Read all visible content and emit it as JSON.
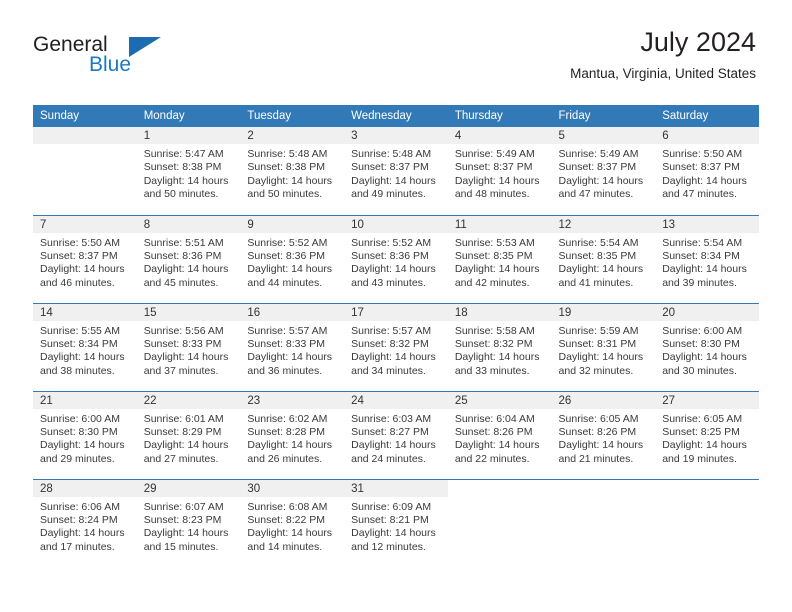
{
  "brand": {
    "word_general": "General",
    "word_blue": "Blue"
  },
  "header": {
    "title": "July 2024",
    "subtitle": "Mantua, Virginia, United States"
  },
  "colors": {
    "header_blue": "#3279b7",
    "logo_blue": "#1b79c3",
    "daynum_band": "#f0f0f0",
    "text": "#231f20"
  },
  "calendar": {
    "weekday_headers": [
      "Sunday",
      "Monday",
      "Tuesday",
      "Wednesday",
      "Thursday",
      "Friday",
      "Saturday"
    ],
    "labels": {
      "sunrise_prefix": "Sunrise:",
      "sunset_prefix": "Sunset:",
      "daylight_prefix": "Daylight:"
    },
    "weeks": [
      [
        {
          "day": "",
          "empty": true,
          "line1": "",
          "line2": "",
          "line3": "",
          "line4": ""
        },
        {
          "day": "1",
          "line1": "Sunrise: 5:47 AM",
          "line2": "Sunset: 8:38 PM",
          "line3": "Daylight: 14 hours",
          "line4": "and 50 minutes."
        },
        {
          "day": "2",
          "line1": "Sunrise: 5:48 AM",
          "line2": "Sunset: 8:38 PM",
          "line3": "Daylight: 14 hours",
          "line4": "and 50 minutes."
        },
        {
          "day": "3",
          "line1": "Sunrise: 5:48 AM",
          "line2": "Sunset: 8:37 PM",
          "line3": "Daylight: 14 hours",
          "line4": "and 49 minutes."
        },
        {
          "day": "4",
          "line1": "Sunrise: 5:49 AM",
          "line2": "Sunset: 8:37 PM",
          "line3": "Daylight: 14 hours",
          "line4": "and 48 minutes."
        },
        {
          "day": "5",
          "line1": "Sunrise: 5:49 AM",
          "line2": "Sunset: 8:37 PM",
          "line3": "Daylight: 14 hours",
          "line4": "and 47 minutes."
        },
        {
          "day": "6",
          "line1": "Sunrise: 5:50 AM",
          "line2": "Sunset: 8:37 PM",
          "line3": "Daylight: 14 hours",
          "line4": "and 47 minutes."
        }
      ],
      [
        {
          "day": "7",
          "line1": "Sunrise: 5:50 AM",
          "line2": "Sunset: 8:37 PM",
          "line3": "Daylight: 14 hours",
          "line4": "and 46 minutes."
        },
        {
          "day": "8",
          "line1": "Sunrise: 5:51 AM",
          "line2": "Sunset: 8:36 PM",
          "line3": "Daylight: 14 hours",
          "line4": "and 45 minutes."
        },
        {
          "day": "9",
          "line1": "Sunrise: 5:52 AM",
          "line2": "Sunset: 8:36 PM",
          "line3": "Daylight: 14 hours",
          "line4": "and 44 minutes."
        },
        {
          "day": "10",
          "line1": "Sunrise: 5:52 AM",
          "line2": "Sunset: 8:36 PM",
          "line3": "Daylight: 14 hours",
          "line4": "and 43 minutes."
        },
        {
          "day": "11",
          "line1": "Sunrise: 5:53 AM",
          "line2": "Sunset: 8:35 PM",
          "line3": "Daylight: 14 hours",
          "line4": "and 42 minutes."
        },
        {
          "day": "12",
          "line1": "Sunrise: 5:54 AM",
          "line2": "Sunset: 8:35 PM",
          "line3": "Daylight: 14 hours",
          "line4": "and 41 minutes."
        },
        {
          "day": "13",
          "line1": "Sunrise: 5:54 AM",
          "line2": "Sunset: 8:34 PM",
          "line3": "Daylight: 14 hours",
          "line4": "and 39 minutes."
        }
      ],
      [
        {
          "day": "14",
          "line1": "Sunrise: 5:55 AM",
          "line2": "Sunset: 8:34 PM",
          "line3": "Daylight: 14 hours",
          "line4": "and 38 minutes."
        },
        {
          "day": "15",
          "line1": "Sunrise: 5:56 AM",
          "line2": "Sunset: 8:33 PM",
          "line3": "Daylight: 14 hours",
          "line4": "and 37 minutes."
        },
        {
          "day": "16",
          "line1": "Sunrise: 5:57 AM",
          "line2": "Sunset: 8:33 PM",
          "line3": "Daylight: 14 hours",
          "line4": "and 36 minutes."
        },
        {
          "day": "17",
          "line1": "Sunrise: 5:57 AM",
          "line2": "Sunset: 8:32 PM",
          "line3": "Daylight: 14 hours",
          "line4": "and 34 minutes."
        },
        {
          "day": "18",
          "line1": "Sunrise: 5:58 AM",
          "line2": "Sunset: 8:32 PM",
          "line3": "Daylight: 14 hours",
          "line4": "and 33 minutes."
        },
        {
          "day": "19",
          "line1": "Sunrise: 5:59 AM",
          "line2": "Sunset: 8:31 PM",
          "line3": "Daylight: 14 hours",
          "line4": "and 32 minutes."
        },
        {
          "day": "20",
          "line1": "Sunrise: 6:00 AM",
          "line2": "Sunset: 8:30 PM",
          "line3": "Daylight: 14 hours",
          "line4": "and 30 minutes."
        }
      ],
      [
        {
          "day": "21",
          "line1": "Sunrise: 6:00 AM",
          "line2": "Sunset: 8:30 PM",
          "line3": "Daylight: 14 hours",
          "line4": "and 29 minutes."
        },
        {
          "day": "22",
          "line1": "Sunrise: 6:01 AM",
          "line2": "Sunset: 8:29 PM",
          "line3": "Daylight: 14 hours",
          "line4": "and 27 minutes."
        },
        {
          "day": "23",
          "line1": "Sunrise: 6:02 AM",
          "line2": "Sunset: 8:28 PM",
          "line3": "Daylight: 14 hours",
          "line4": "and 26 minutes."
        },
        {
          "day": "24",
          "line1": "Sunrise: 6:03 AM",
          "line2": "Sunset: 8:27 PM",
          "line3": "Daylight: 14 hours",
          "line4": "and 24 minutes."
        },
        {
          "day": "25",
          "line1": "Sunrise: 6:04 AM",
          "line2": "Sunset: 8:26 PM",
          "line3": "Daylight: 14 hours",
          "line4": "and 22 minutes."
        },
        {
          "day": "26",
          "line1": "Sunrise: 6:05 AM",
          "line2": "Sunset: 8:26 PM",
          "line3": "Daylight: 14 hours",
          "line4": "and 21 minutes."
        },
        {
          "day": "27",
          "line1": "Sunrise: 6:05 AM",
          "line2": "Sunset: 8:25 PM",
          "line3": "Daylight: 14 hours",
          "line4": "and 19 minutes."
        }
      ],
      [
        {
          "day": "28",
          "line1": "Sunrise: 6:06 AM",
          "line2": "Sunset: 8:24 PM",
          "line3": "Daylight: 14 hours",
          "line4": "and 17 minutes."
        },
        {
          "day": "29",
          "line1": "Sunrise: 6:07 AM",
          "line2": "Sunset: 8:23 PM",
          "line3": "Daylight: 14 hours",
          "line4": "and 15 minutes."
        },
        {
          "day": "30",
          "line1": "Sunrise: 6:08 AM",
          "line2": "Sunset: 8:22 PM",
          "line3": "Daylight: 14 hours",
          "line4": "and 14 minutes."
        },
        {
          "day": "31",
          "line1": "Sunrise: 6:09 AM",
          "line2": "Sunset: 8:21 PM",
          "line3": "Daylight: 14 hours",
          "line4": "and 12 minutes."
        },
        {
          "day": "",
          "blank": true,
          "line1": "",
          "line2": "",
          "line3": "",
          "line4": ""
        },
        {
          "day": "",
          "blank": true,
          "line1": "",
          "line2": "",
          "line3": "",
          "line4": ""
        },
        {
          "day": "",
          "blank": true,
          "line1": "",
          "line2": "",
          "line3": "",
          "line4": ""
        }
      ]
    ]
  }
}
